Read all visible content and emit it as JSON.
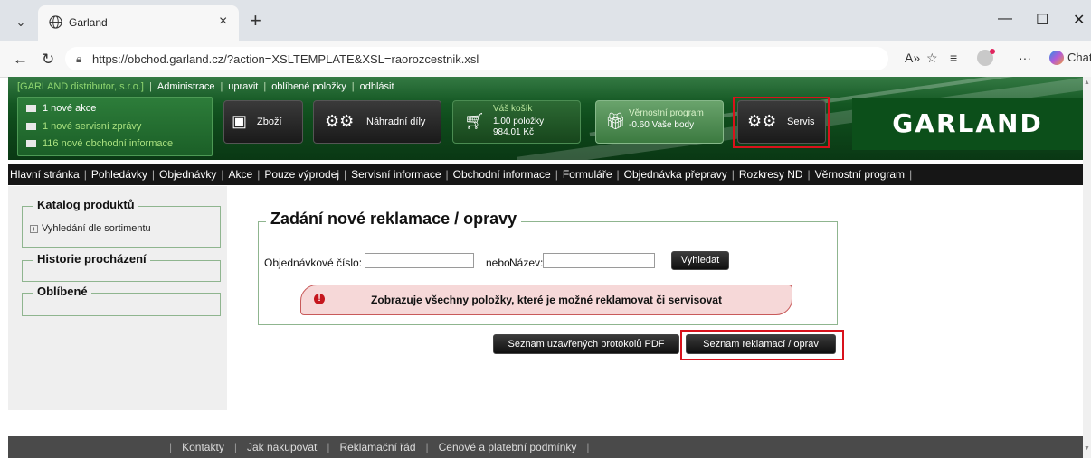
{
  "browser": {
    "tab_title": "Garland",
    "url": "https://obchod.garland.cz/?action=XSLTEMPLATE&XSL=raorozcestnik.xsl",
    "chat_label": "Chat"
  },
  "header": {
    "company": "[GARLAND distributor, s.r.o.]",
    "links": [
      "Administrace",
      "upravit",
      "oblíbené položky",
      "odhlásit"
    ],
    "messages": [
      "1 nové akce",
      "1 nové servisní zprávy",
      "116 nové obchodní informace"
    ],
    "buttons": {
      "goods": "Zboží",
      "spare_parts": "Náhradní díly",
      "service": "Servis"
    },
    "cart": {
      "title": "Váš košík",
      "items": "1.00 položky",
      "price": "984.01 Kč"
    },
    "loyalty": {
      "title": "Věrnostní program",
      "points": "-0.60 Vaše body"
    },
    "logo": "GARLAND"
  },
  "main_nav": [
    "Hlavní stránka",
    "Pohledávky",
    "Objednávky",
    "Akce",
    "Pouze výprodej",
    "Servisní informace",
    "Obchodní informace",
    "Formuláře",
    "Objednávka přepravy",
    "Rozkresy ND",
    "Věrnostní program"
  ],
  "sidebar": {
    "catalog_title": "Katalog produktů",
    "catalog_item": "Vyhledání dle sortimentu",
    "history_title": "Historie procházení",
    "favorites_title": "Oblíbené"
  },
  "form": {
    "title": "Zadání nové reklamace / opravy",
    "order_label": "Objednávkové číslo:",
    "or_label": "nebo",
    "name_label": "Název:",
    "order_value": "",
    "name_value": "",
    "search_button": "Vyhledat",
    "alert": "Zobrazuje všechny položky, které je možné reklamovat či servisovat"
  },
  "actions": {
    "closed_protocols": "Seznam uzavřených protokolů PDF",
    "claims_list": "Seznam reklamací / oprav"
  },
  "footer": [
    "Kontakty",
    "Jak nakupovat",
    "Reklamační řád",
    "Cenové a platební podmínky"
  ],
  "colors": {
    "header_green": "#0e4a1b",
    "highlight_red": "#d8121c",
    "alert_bg": "#f6d8d8"
  }
}
